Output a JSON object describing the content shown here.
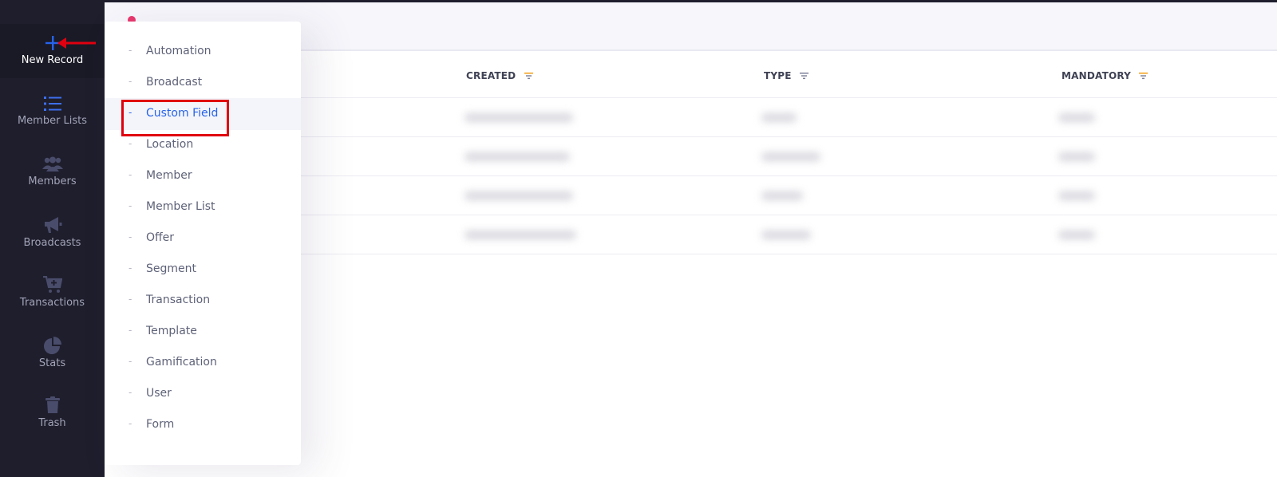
{
  "sidebar": {
    "items": [
      {
        "label": "New Record",
        "icon": "plus-icon"
      },
      {
        "label": "Member Lists",
        "icon": "list-icon"
      },
      {
        "label": "Members",
        "icon": "users-icon"
      },
      {
        "label": "Broadcasts",
        "icon": "megaphone-icon"
      },
      {
        "label": "Transactions",
        "icon": "cart-icon"
      },
      {
        "label": "Stats",
        "icon": "pie-chart-icon"
      },
      {
        "label": "Trash",
        "icon": "trash-icon"
      }
    ]
  },
  "table": {
    "columns": [
      {
        "label": "CREATED"
      },
      {
        "label": "TYPE"
      },
      {
        "label": "MANDATORY"
      }
    ],
    "row_count_visible": 4
  },
  "menu": {
    "items": [
      {
        "label": "Automation"
      },
      {
        "label": "Broadcast"
      },
      {
        "label": "Custom Field",
        "active": true
      },
      {
        "label": "Location"
      },
      {
        "label": "Member"
      },
      {
        "label": "Member List"
      },
      {
        "label": "Offer"
      },
      {
        "label": "Segment"
      },
      {
        "label": "Transaction"
      },
      {
        "label": "Template"
      },
      {
        "label": "Gamification"
      },
      {
        "label": "User"
      },
      {
        "label": "Form"
      }
    ],
    "dash": "-"
  },
  "colors": {
    "sidebar_bg": "#1e1e2d",
    "accent": "#2663eb",
    "annotation": "#e0000f",
    "sort_icon": "#f39c12"
  }
}
